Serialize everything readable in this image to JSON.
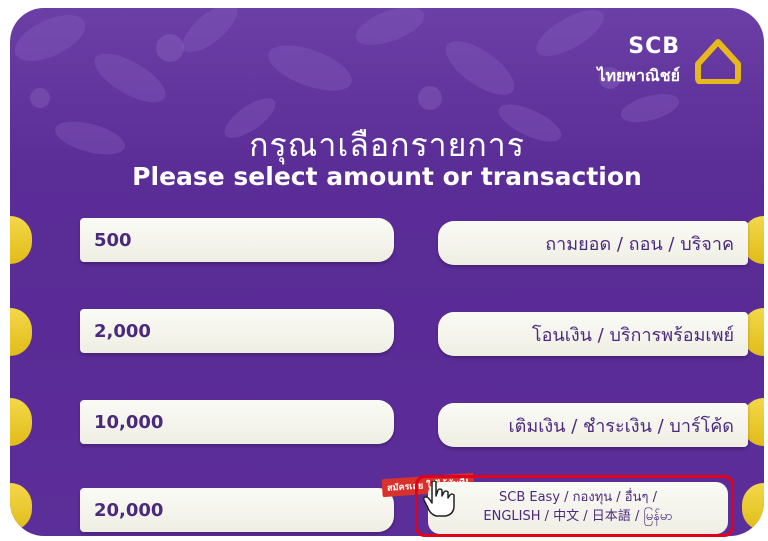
{
  "brand": {
    "name": "SCB",
    "subname": "ไทยพาณิชย์"
  },
  "header": {
    "title_thai": "กรุณาเลือกรายการ",
    "title_english": "Please select amount or transaction"
  },
  "amounts": {
    "a1": "500",
    "a2": "2,000",
    "a3": "10,000",
    "a4": "20,000"
  },
  "transactions": {
    "t1": "ถามยอด / ถอน / บริจาค",
    "t2": "โอนเงิน / บริการพร้อมเพย์",
    "t3": "เติมเงิน / ชำระเงิน / บาร์โค้ด",
    "t4_line1": "SCB Easy / กองทุน / อื่นๆ /",
    "t4_line2": "ENGLISH / 中文 / 日本語 / မြန်မာ"
  },
  "promo_label": "สมัครเลย ใช้ได้ทันที!",
  "colors": {
    "background": "#5b2d97",
    "accent_yellow": "#e8c52a",
    "button_text": "#4b2a7d",
    "highlight_border": "#e3001b"
  },
  "icons": {
    "logo": "scb-house-logo-icon",
    "cursor": "hand-pointer-icon"
  }
}
